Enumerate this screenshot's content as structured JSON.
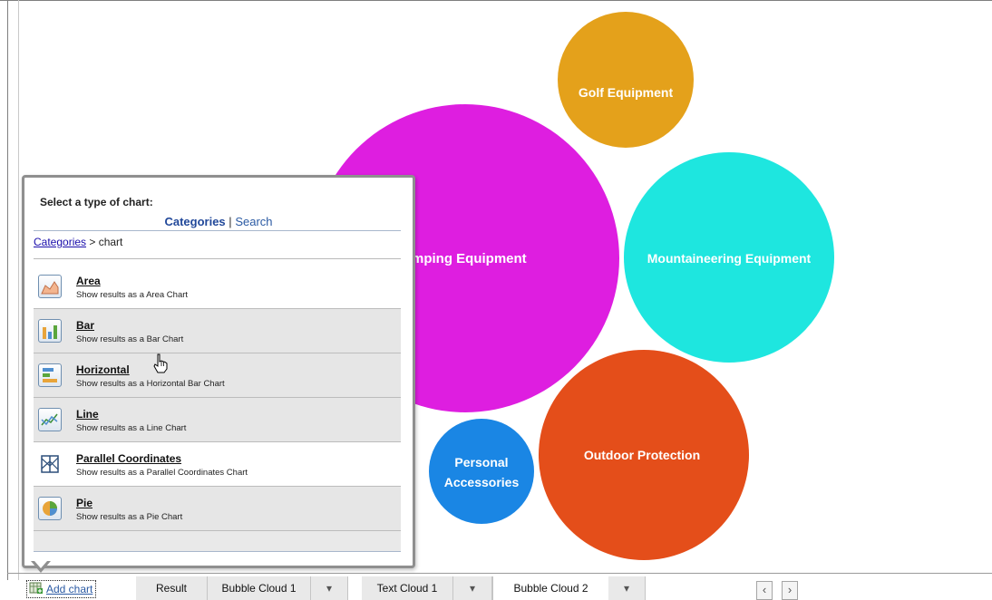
{
  "bubbles": [
    {
      "label": "Camping Equipment",
      "shown_text": "mping Equipment",
      "color": "#de1ee0"
    },
    {
      "label": "Golf Equipment",
      "shown_text": "Golf Equipment",
      "color": "#e4a11b"
    },
    {
      "label": "Mountaineering Equipment",
      "shown_text": "Mountaineering Equipment",
      "color": "#1ee6df"
    },
    {
      "label": "Outdoor Protection",
      "shown_text": "Outdoor Protection",
      "color": "#e44e1a"
    },
    {
      "label": "Personal Accessories",
      "shown_text_line1": "Personal",
      "shown_text_line2": "Accessories",
      "color": "#1a86e4"
    }
  ],
  "popup": {
    "title": "Select a type of chart:",
    "nav_categories": "Categories",
    "nav_separator": "|",
    "nav_search": "Search",
    "breadcrumb_link": "Categories",
    "breadcrumb_rest": " > chart",
    "items": [
      {
        "name": "Area",
        "desc": "Show results as a Area Chart",
        "icon": "area-chart-icon"
      },
      {
        "name": "Bar",
        "desc": "Show results as a Bar Chart",
        "icon": "bar-chart-icon"
      },
      {
        "name": "Horizontal",
        "desc": "Show results as a Horizontal Bar Chart",
        "icon": "horizontal-bar-chart-icon"
      },
      {
        "name": "Line",
        "desc": "Show results as a Line Chart",
        "icon": "line-chart-icon"
      },
      {
        "name": "Parallel Coordinates",
        "desc": "Show results as a Parallel Coordinates Chart",
        "icon": "parallel-coordinates-icon"
      },
      {
        "name": "Pie",
        "desc": "Show results as a Pie Chart",
        "icon": "pie-chart-icon"
      }
    ]
  },
  "tabbar": {
    "add_chart": "Add chart",
    "tabs": [
      "Result",
      "Bubble Cloud 1",
      "Text Cloud 1",
      "Bubble Cloud 2"
    ],
    "dropdown_glyph": "▾",
    "prev": "‹",
    "next": "›"
  }
}
